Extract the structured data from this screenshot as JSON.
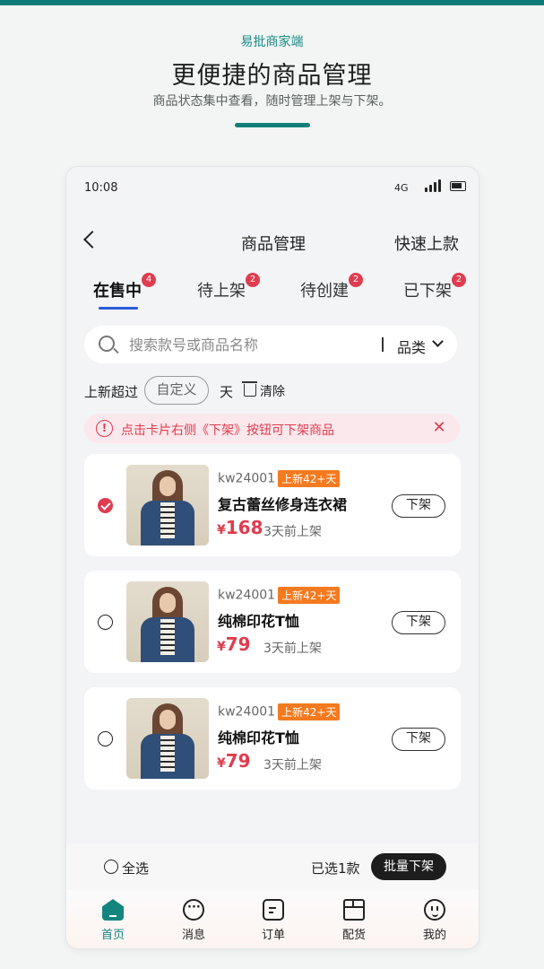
{
  "header": {
    "brand": "易批商家端",
    "headline": "更便捷的商品管理",
    "subline": "商品状态集中查看，随时管理上架与下架。"
  },
  "status_bar": {
    "time": "10:08",
    "network": "4G"
  },
  "nav": {
    "title": "商品管理",
    "action": "快速上款",
    "back_icon": "chevron-left-icon"
  },
  "tabs": [
    {
      "label": "在售中",
      "badge": "4",
      "active": true
    },
    {
      "label": "待上架",
      "badge": "2"
    },
    {
      "label": "待创建",
      "badge": "2"
    },
    {
      "label": "已下架",
      "badge": "2"
    }
  ],
  "search": {
    "placeholder": "搜索款号或商品名称",
    "value": "",
    "category_label": "品类"
  },
  "filter": {
    "label": "上新超过",
    "custom_label": "自定义",
    "unit": "天",
    "clear_label": "清除"
  },
  "notice": {
    "text": "点击卡片右侧《下架》按钮可下架商品",
    "color": "#e03c4f"
  },
  "products": [
    {
      "sku": "kw24001",
      "tag": "上新42+天",
      "name": "复古蕾丝修身连衣裙",
      "currency": "¥",
      "price": "168",
      "listed": "3天前上架",
      "action": "下架",
      "selected": true
    },
    {
      "sku": "kw24001",
      "tag": "上新42+天",
      "name": "纯棉印花T恤",
      "currency": "¥",
      "price": "79",
      "listed": "3天前上架",
      "action": "下架",
      "selected": false
    },
    {
      "sku": "kw24001",
      "tag": "上新42+天",
      "name": "纯棉印花T恤",
      "currency": "¥",
      "price": "79",
      "listed": "3天前上架",
      "action": "下架",
      "selected": false
    }
  ],
  "bottom_bar": {
    "select_all": "全选",
    "selected_count": "已选1款",
    "batch_action": "批量下架"
  },
  "tabbar": [
    {
      "label": "首页",
      "icon": "home-icon",
      "active": true
    },
    {
      "label": "消息",
      "icon": "message-icon"
    },
    {
      "label": "订单",
      "icon": "order-icon"
    },
    {
      "label": "配货",
      "icon": "box-icon"
    },
    {
      "label": "我的",
      "icon": "profile-icon"
    }
  ],
  "colors": {
    "brand": "#127e7a",
    "accent_red": "#e03c4f",
    "tag_orange": "#f47a1f",
    "tab_underline": "#2a5bd7"
  }
}
